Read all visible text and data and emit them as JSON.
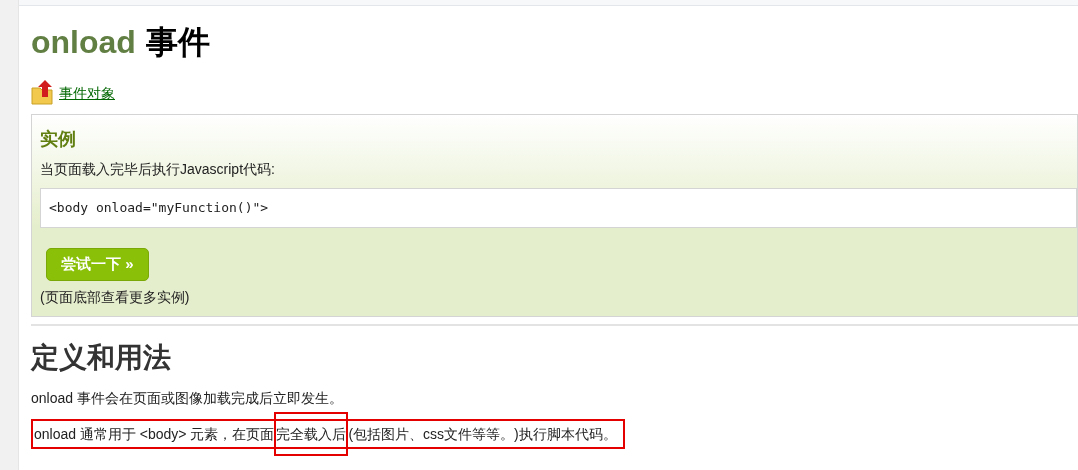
{
  "title": {
    "keyword": "onload",
    "rest": "事件"
  },
  "object_link": "事件对象",
  "example": {
    "heading": "实例",
    "description": "当页面载入完毕后执行Javascript代码:",
    "code": "<body onload=\"myFunction()\">",
    "button": "尝试一下 »",
    "note": "(页面底部查看更多实例)"
  },
  "section": {
    "heading": "定义和用法",
    "paragraphs": [
      {
        "kind": "plain",
        "parts": [
          "onload 事件会在页面或图像加载完成后立即发生。"
        ]
      },
      {
        "kind": "highlighted",
        "parts": [
          "onload 通常用于 <body> 元素，在页面",
          "完全载入后",
          "(包括图片、css文件等等。)执行脚本代码。"
        ]
      }
    ]
  }
}
